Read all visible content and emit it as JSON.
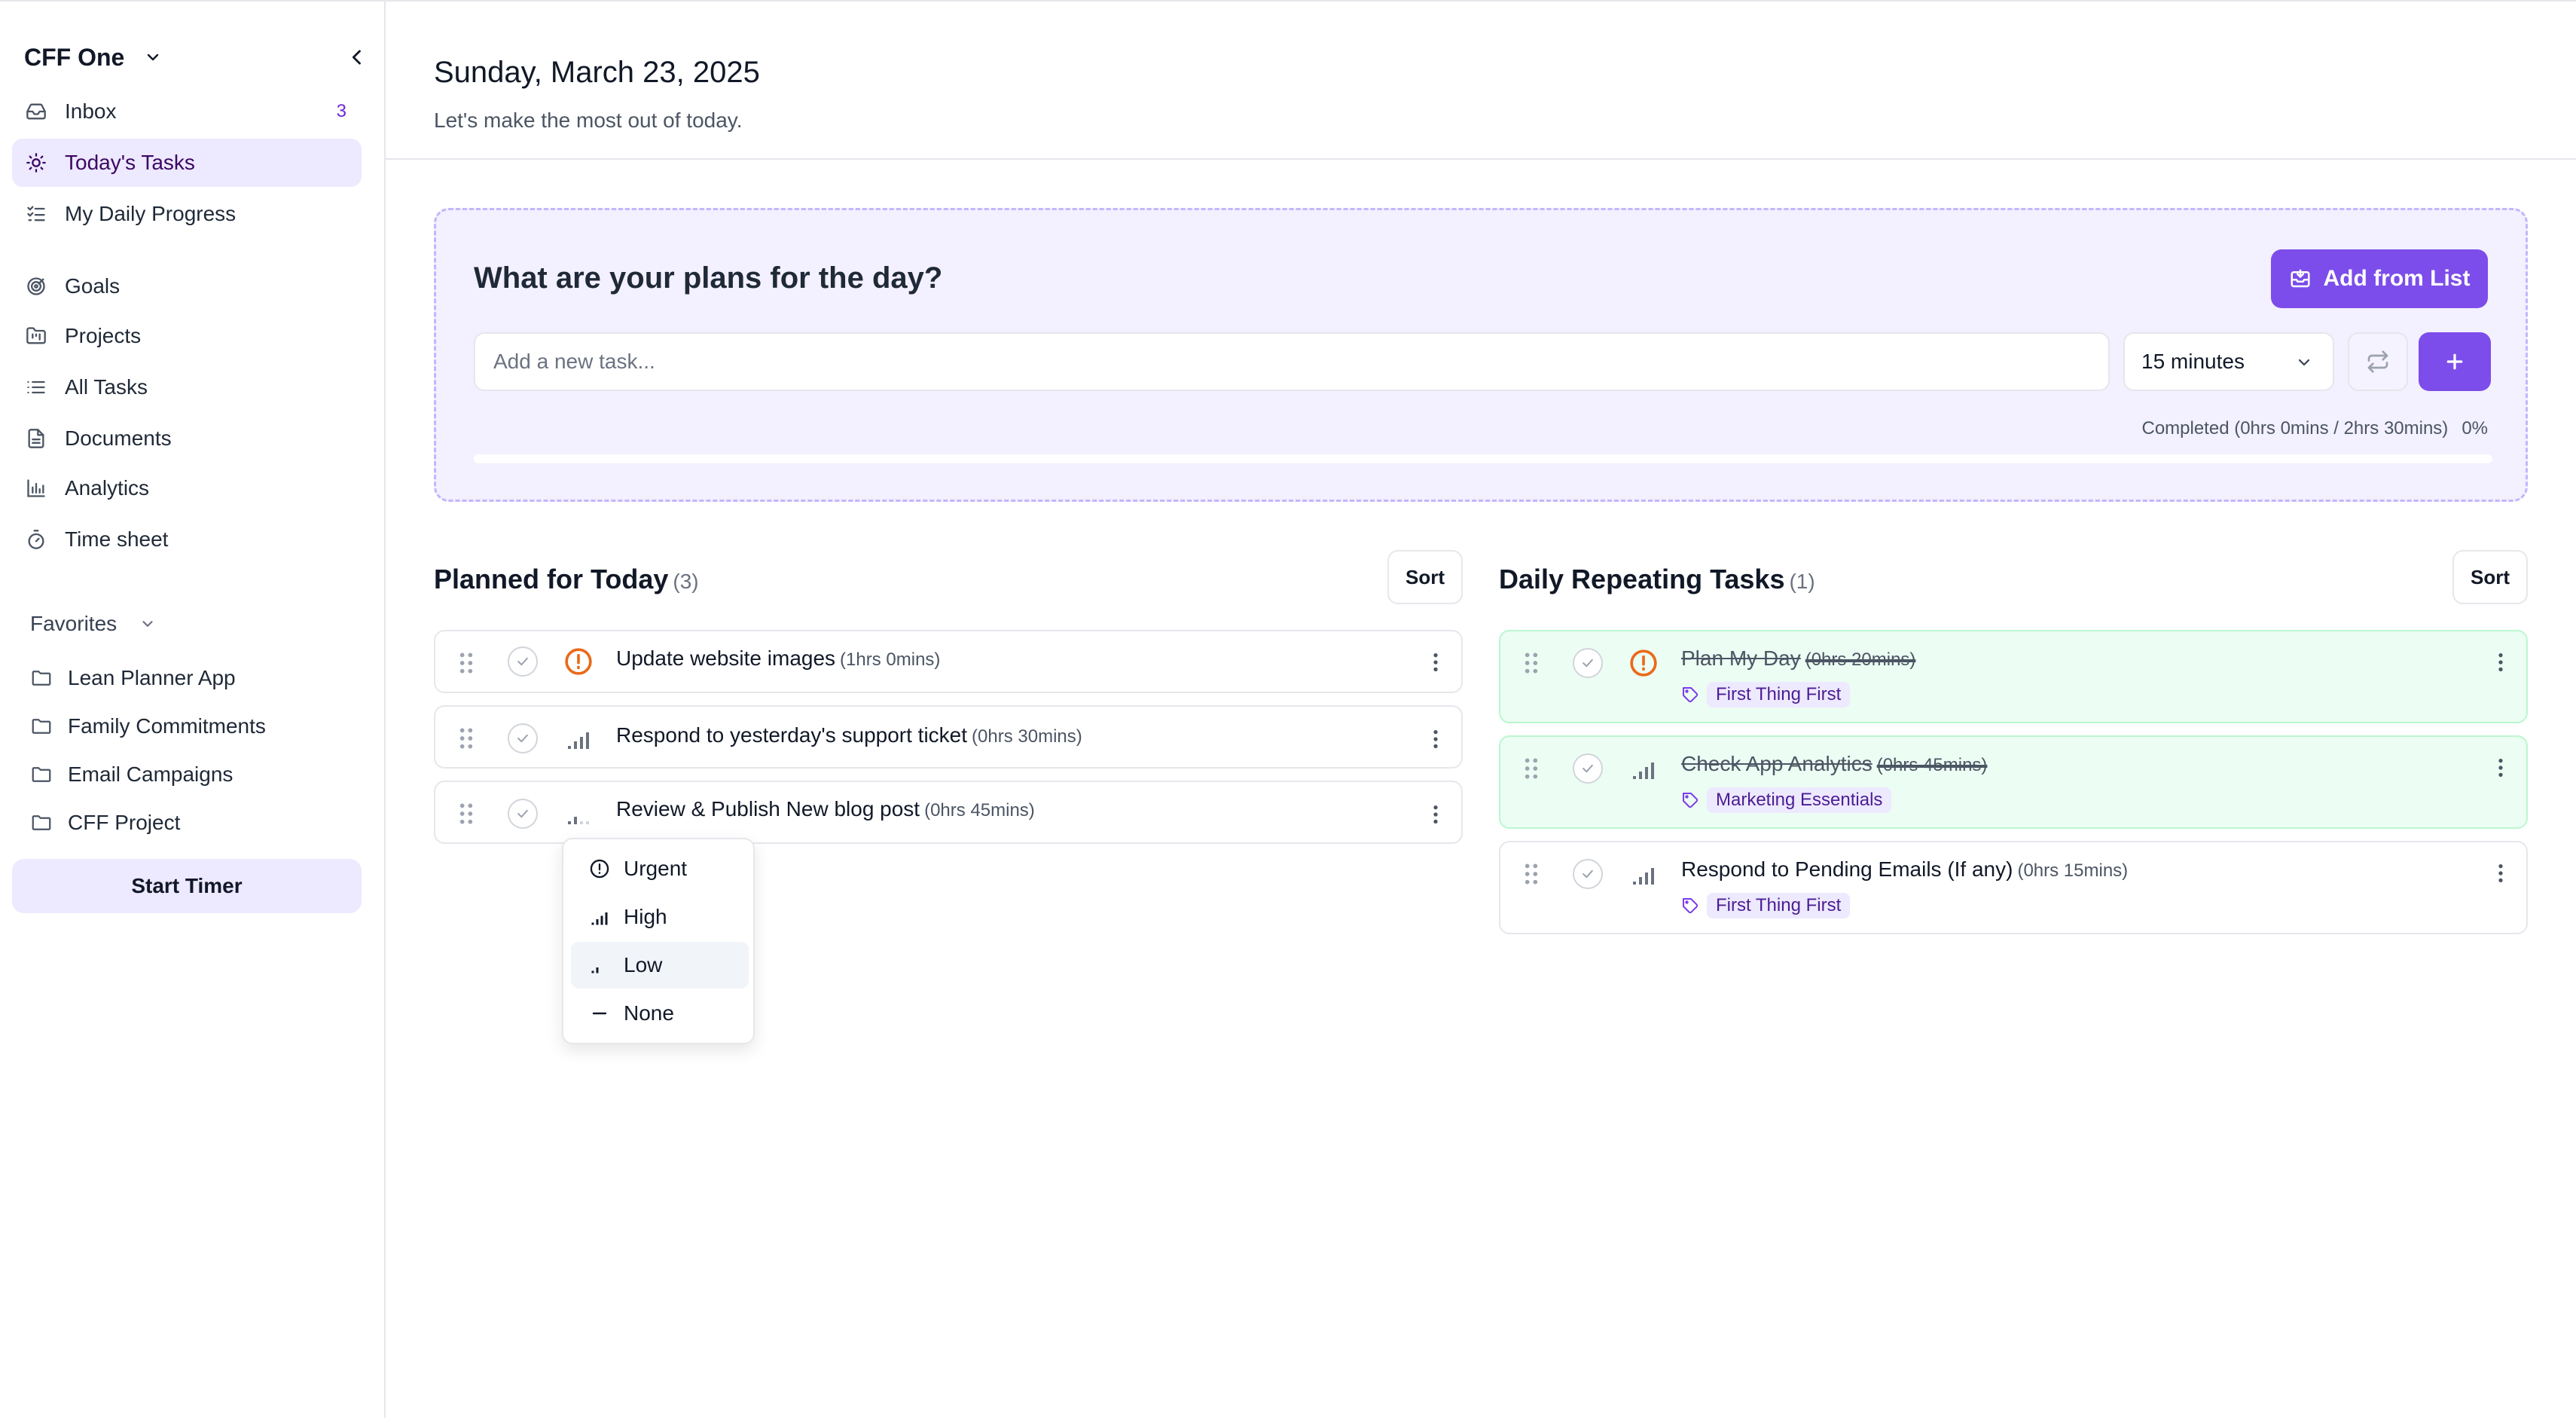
{
  "sidebar": {
    "workspace": "CFF One",
    "nav": [
      {
        "label": "Inbox",
        "icon": "inbox-icon",
        "badge": "3"
      },
      {
        "label": "Today's Tasks",
        "icon": "sun-icon",
        "active": true
      },
      {
        "label": "My Daily Progress",
        "icon": "checklist-icon"
      },
      {
        "label": "Goals",
        "icon": "target-icon"
      },
      {
        "label": "Projects",
        "icon": "folder-kanban-icon"
      },
      {
        "label": "All Tasks",
        "icon": "list-icon"
      },
      {
        "label": "Documents",
        "icon": "document-icon"
      },
      {
        "label": "Analytics",
        "icon": "bar-chart-icon"
      },
      {
        "label": "Time sheet",
        "icon": "stopwatch-icon"
      }
    ],
    "favorites_label": "Favorites",
    "favorites": [
      {
        "label": "Lean Planner App",
        "icon": "folder-icon"
      },
      {
        "label": "Family Commitments",
        "icon": "folder-icon"
      },
      {
        "label": "Email Campaigns",
        "icon": "folder-icon"
      },
      {
        "label": "CFF Project",
        "icon": "folder-icon"
      }
    ],
    "start_timer": "Start Timer"
  },
  "header": {
    "date": "Sunday, March 23, 2025",
    "subtitle": "Let's make the most out of today."
  },
  "plans": {
    "title": "What are your plans for the day?",
    "add_from_list": "Add from List",
    "input_placeholder": "Add a new task...",
    "duration": "15 minutes",
    "completed_text": "Completed (0hrs 0mins / 2hrs 30mins)",
    "completed_percent": "0%",
    "progress_fraction": 0,
    "accent_color": "#7c4dea"
  },
  "planned": {
    "title": "Planned for Today",
    "count": "(3)",
    "sort": "Sort",
    "tasks": [
      {
        "name": "Update website images",
        "duration": "(1hrs 0mins)",
        "priority": "urgent-icon"
      },
      {
        "name": "Respond to yesterday's support ticket",
        "duration": "(0hrs 30mins)",
        "priority": "high-priority-icon"
      },
      {
        "name": "Review & Publish New blog post",
        "duration": "(0hrs 45mins)",
        "priority": "low-priority-icon"
      }
    ]
  },
  "repeating": {
    "title": "Daily Repeating Tasks",
    "count": "(1)",
    "sort": "Sort",
    "tasks": [
      {
        "name": "Plan My Day",
        "duration": "(0hrs 20mins)",
        "tag": "First Thing First",
        "completed": true,
        "priority": "urgent-icon"
      },
      {
        "name": "Check App Analytics",
        "duration": "(0hrs 45mins)",
        "tag": "Marketing Essentials",
        "completed": true,
        "priority": "high-priority-icon"
      },
      {
        "name": "Respond to Pending Emails (If any)",
        "duration": "(0hrs 15mins)",
        "tag": "First Thing First",
        "completed": false,
        "priority": "high-priority-icon"
      }
    ]
  },
  "priority_menu": {
    "options": [
      {
        "label": "Urgent",
        "icon": "urgent-icon"
      },
      {
        "label": "High",
        "icon": "high-priority-icon"
      },
      {
        "label": "Low",
        "icon": "low-priority-icon",
        "highlighted": true
      },
      {
        "label": "None",
        "icon": "no-priority-icon"
      }
    ]
  }
}
